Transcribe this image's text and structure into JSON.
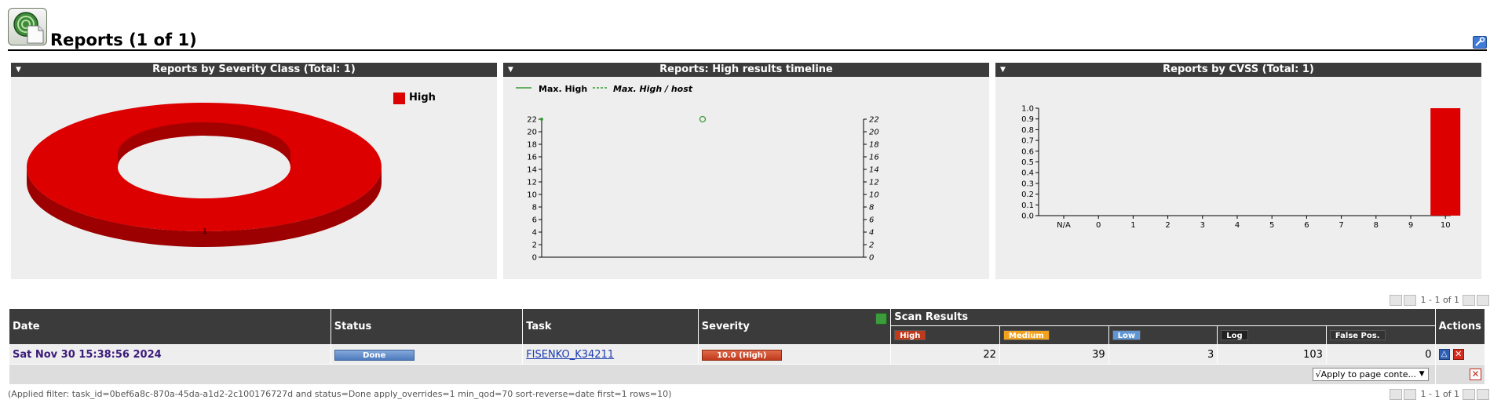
{
  "page": {
    "title": "Reports (1 of 1)"
  },
  "panels": {
    "severity": {
      "title": "Reports by Severity Class (Total: 1)",
      "legend": "High",
      "slice_label": "1",
      "color": "#dd0000"
    },
    "timeline": {
      "title": "Reports: High results timeline",
      "legend_max": "Max. High",
      "legend_host": "Max. High / host"
    },
    "cvss": {
      "title": "Reports by CVSS (Total: 1)"
    }
  },
  "chart_data": [
    {
      "type": "pie",
      "title": "Reports by Severity Class (Total: 1)",
      "categories": [
        "High"
      ],
      "values": [
        1
      ],
      "colors": [
        "#dd0000"
      ]
    },
    {
      "type": "line",
      "title": "Reports: High results timeline",
      "yticks": [
        0,
        2,
        4,
        6,
        8,
        10,
        12,
        14,
        16,
        18,
        20,
        22
      ],
      "ylim": [
        0,
        22
      ],
      "series": [
        {
          "name": "Max. High",
          "points": [
            {
              "x": 0,
              "y": 22
            }
          ]
        },
        {
          "name": "Max. High / host",
          "points": [
            {
              "x": 0.5,
              "y": 22
            }
          ]
        }
      ]
    },
    {
      "type": "bar",
      "title": "Reports by CVSS (Total: 1)",
      "categories": [
        "N/A",
        "0",
        "1",
        "2",
        "3",
        "4",
        "5",
        "6",
        "7",
        "8",
        "9",
        "10"
      ],
      "values": [
        0,
        0,
        0,
        0,
        0,
        0,
        0,
        0,
        0,
        0,
        0,
        1.0
      ],
      "yticks": [
        "0.0",
        "0.1",
        "0.2",
        "0.3",
        "0.4",
        "0.5",
        "0.6",
        "0.7",
        "0.8",
        "0.9",
        "1.0"
      ],
      "ylim": [
        0,
        1.0
      ]
    }
  ],
  "pager": {
    "text": "1 - 1 of 1"
  },
  "table": {
    "headers": {
      "date": "Date",
      "status": "Status",
      "task": "Task",
      "severity": "Severity",
      "scan_results": "Scan Results",
      "actions": "Actions"
    },
    "sub_headers": {
      "high": "High",
      "medium": "Medium",
      "low": "Low",
      "log": "Log",
      "false_pos": "False Pos."
    },
    "row": {
      "date": "Sat Nov 30 15:38:56 2024",
      "status": "Done",
      "task": "FISENKO_K34211",
      "severity": "10.0 (High)",
      "high": "22",
      "medium": "39",
      "low": "3",
      "log": "103",
      "false_pos": "0"
    },
    "apply_select": "√Apply to page conte..."
  },
  "filter_text": "(Applied filter: task_id=0bef6a8c-870a-45da-a1d2-2c100176727d and status=Done apply_overrides=1 min_qod=70 sort-reverse=date first=1 rows=10)"
}
